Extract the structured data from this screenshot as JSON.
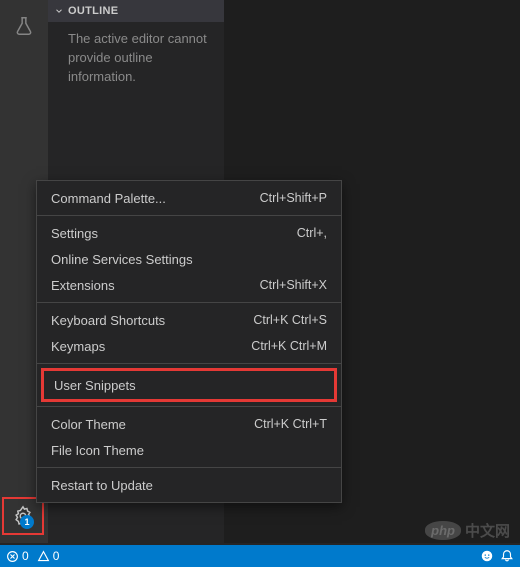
{
  "sidebar": {
    "outline_title": "OUTLINE",
    "outline_message": "The active editor cannot provide outline information."
  },
  "gear_badge": "1",
  "menu": {
    "items": [
      {
        "label": "Command Palette...",
        "shortcut": "Ctrl+Shift+P",
        "highlight": false
      },
      {
        "sep": true
      },
      {
        "label": "Settings",
        "shortcut": "Ctrl+,",
        "highlight": false
      },
      {
        "label": "Online Services Settings",
        "shortcut": "",
        "highlight": false
      },
      {
        "label": "Extensions",
        "shortcut": "Ctrl+Shift+X",
        "highlight": false
      },
      {
        "sep": true
      },
      {
        "label": "Keyboard Shortcuts",
        "shortcut": "Ctrl+K Ctrl+S",
        "highlight": false
      },
      {
        "label": "Keymaps",
        "shortcut": "Ctrl+K Ctrl+M",
        "highlight": false
      },
      {
        "sep": true
      },
      {
        "label": "User Snippets",
        "shortcut": "",
        "highlight": true
      },
      {
        "sep": true
      },
      {
        "label": "Color Theme",
        "shortcut": "Ctrl+K Ctrl+T",
        "highlight": false
      },
      {
        "label": "File Icon Theme",
        "shortcut": "",
        "highlight": false
      },
      {
        "sep": true
      },
      {
        "label": "Restart to Update",
        "shortcut": "",
        "highlight": false
      }
    ]
  },
  "statusbar": {
    "errors": "0",
    "warnings": "0"
  },
  "watermark": {
    "logo": "php",
    "text": "中文网"
  }
}
